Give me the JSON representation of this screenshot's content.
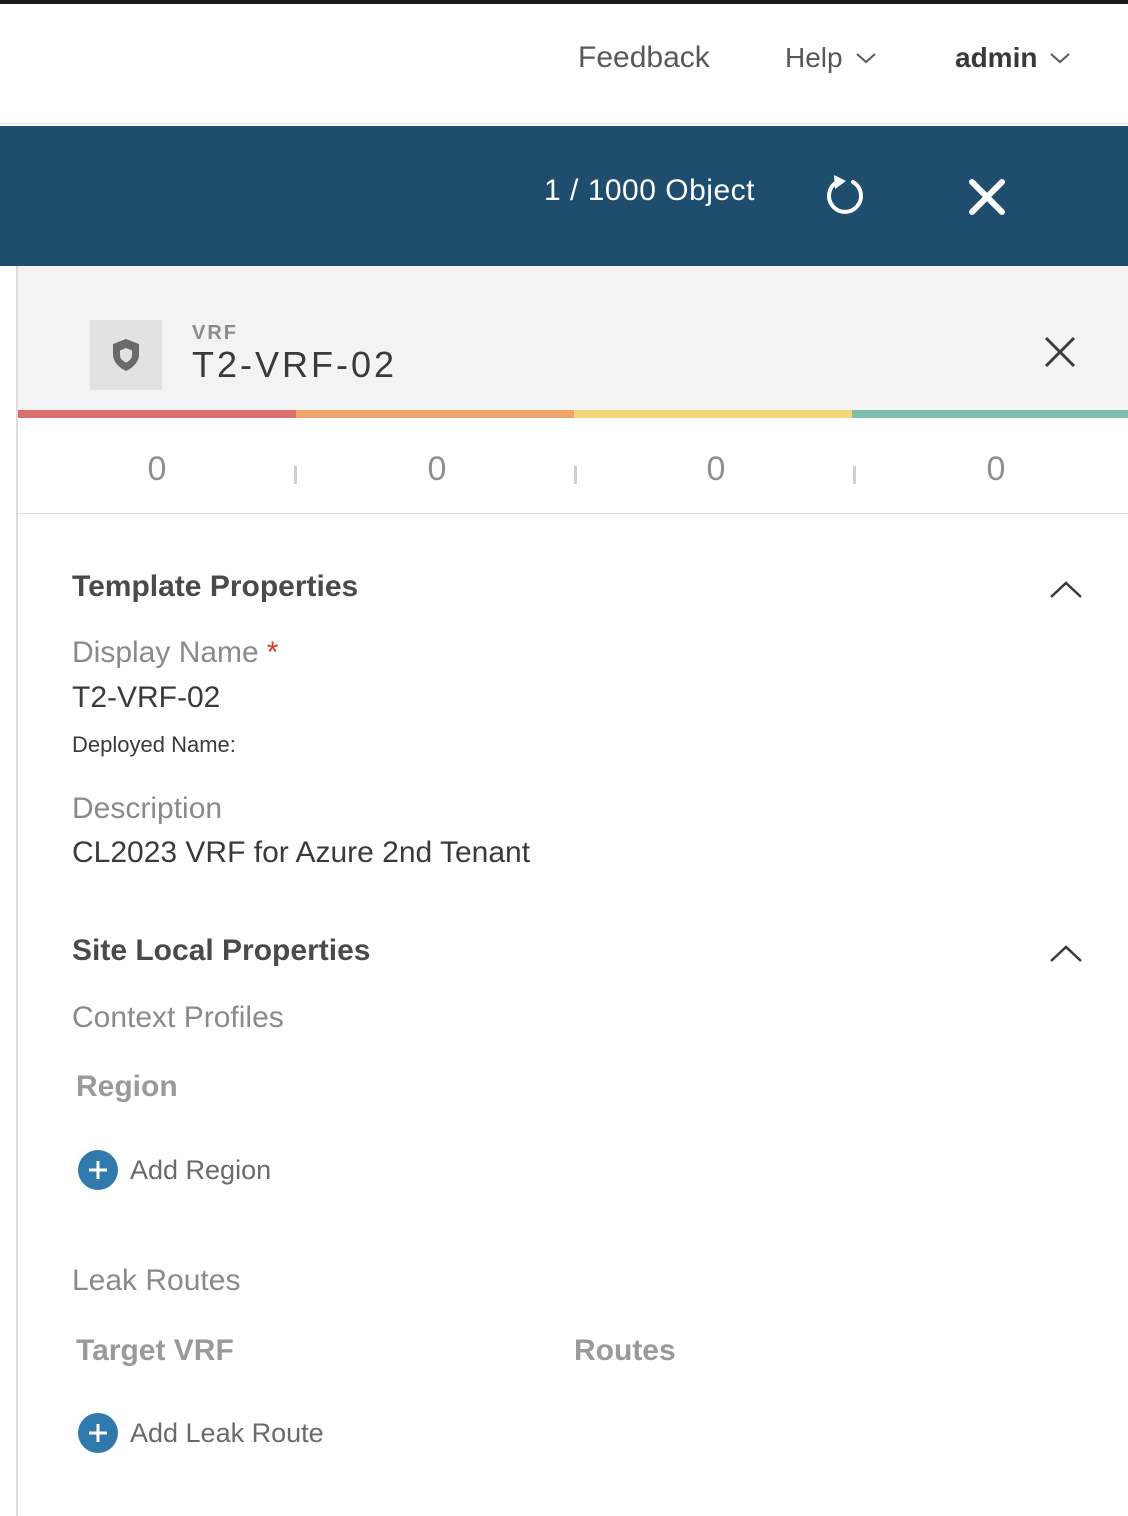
{
  "header": {
    "feedback_label": "Feedback",
    "help_label": "Help",
    "user_label": "admin"
  },
  "toolbar": {
    "object_count": "1 / 1000 Object",
    "refresh_icon": "refresh-icon",
    "close_icon": "close-icon"
  },
  "panel": {
    "object_type": "VRF",
    "object_name": "T2-VRF-02",
    "icon": "shield-icon",
    "health_colors": [
      "#d9706d",
      "#eda46b",
      "#f5d77a",
      "#7fbfae"
    ],
    "fault_counts": [
      "0",
      "0",
      "0",
      "0"
    ]
  },
  "template_properties": {
    "title": "Template Properties",
    "display_name_label": "Display Name",
    "required_marker": "*",
    "display_name_value": "T2-VRF-02",
    "deployed_name_label": "Deployed Name:",
    "description_label": "Description",
    "description_value": "CL2023 VRF for Azure 2nd Tenant"
  },
  "site_local_properties": {
    "title": "Site Local Properties",
    "context_profiles_label": "Context Profiles",
    "region_header": "Region",
    "add_region_label": "Add Region",
    "leak_routes_label": "Leak Routes",
    "target_vrf_header": "Target VRF",
    "routes_header": "Routes",
    "add_leak_route_label": "Add Leak Route"
  },
  "colors": {
    "brand_bar": "#1f4d6e",
    "add_button": "#2f79ad",
    "required": "#d9382c"
  }
}
